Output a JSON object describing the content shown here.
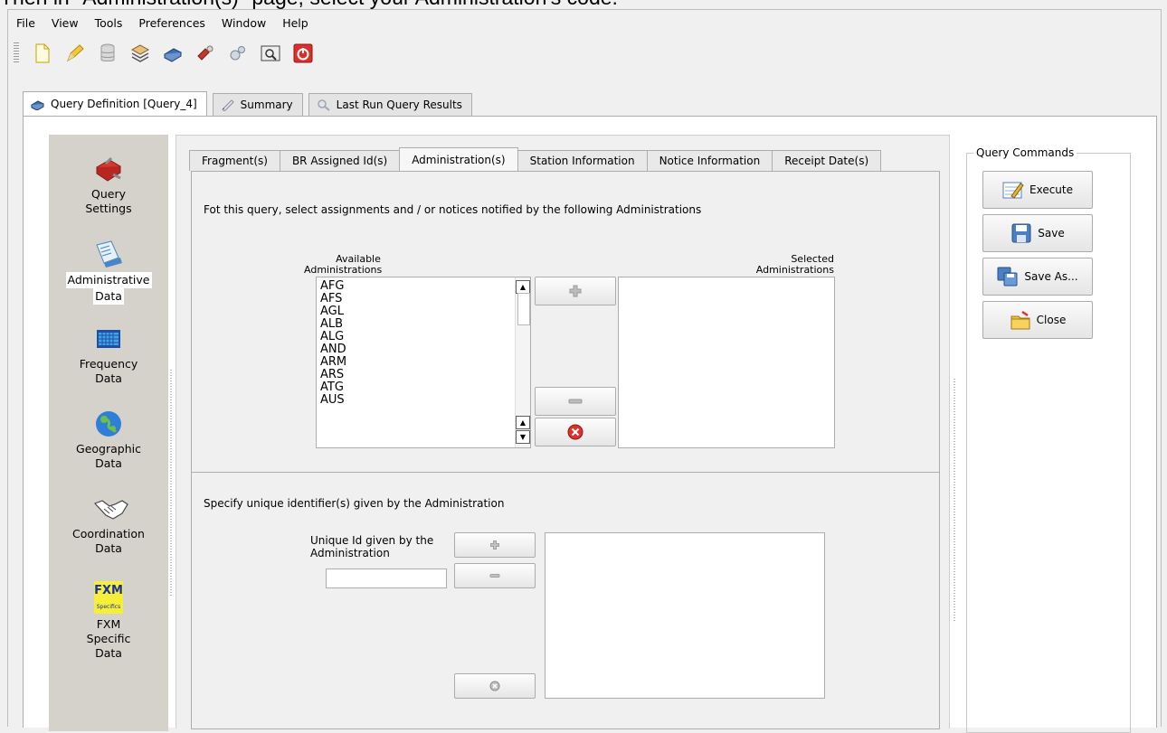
{
  "caption": "Then in \"Administration(s)\" page, select your Administration's code.",
  "menu": [
    "File",
    "View",
    "Tools",
    "Preferences",
    "Window",
    "Help"
  ],
  "main_tabs": [
    {
      "label": "Query Definition [Query_4]",
      "icon": "query-definition-icon"
    },
    {
      "label": "Summary",
      "icon": "summary-icon"
    },
    {
      "label": "Last Run Query Results",
      "icon": "search-results-icon"
    }
  ],
  "sidebar": [
    {
      "label1": "Query",
      "label2": "Settings",
      "icon": "toolbox-icon"
    },
    {
      "label1": "Administrative",
      "label2": "Data",
      "icon": "calendar-data-icon"
    },
    {
      "label1": "Frequency",
      "label2": "Data",
      "icon": "frequency-grid-icon"
    },
    {
      "label1": "Geographic",
      "label2": "Data",
      "icon": "globe-icon"
    },
    {
      "label1": "Coordination",
      "label2": "Data",
      "icon": "handshake-icon"
    },
    {
      "label1": "FXM",
      "label2": "Specific",
      "label3": "Data",
      "icon": "fxm-specifics-icon",
      "logo_text": "FXM",
      "logo_sub": "Specifics"
    }
  ],
  "sub_tabs": [
    "Fragment(s)",
    "BR Assigned Id(s)",
    "Administration(s)",
    "Station Information",
    "Notice Information",
    "Receipt Date(s)"
  ],
  "admin_section": {
    "instruction": "Fot this query, select assignments and / or notices notified by the following Administrations",
    "available_label1": "Available",
    "available_label2": "Administrations",
    "selected_label1": "Selected",
    "selected_label2": "Administrations",
    "available_items": [
      "AFG",
      "AFS",
      "AGL",
      "ALB",
      "ALG",
      "AND",
      "ARM",
      "ARS",
      "ATG",
      "AUS"
    ]
  },
  "uid_section": {
    "instruction": "Specify unique identifier(s) given by the Administration",
    "label1": "Unique Id given by the",
    "label2": "Administration",
    "input_value": ""
  },
  "query_commands": {
    "title": "Query Commands",
    "buttons": [
      {
        "label": "Execute",
        "icon": "execute-icon"
      },
      {
        "label": "Save",
        "icon": "save-icon"
      },
      {
        "label": "Save As...",
        "icon": "save-as-icon"
      },
      {
        "label": "Close",
        "icon": "close-folder-icon"
      }
    ]
  }
}
